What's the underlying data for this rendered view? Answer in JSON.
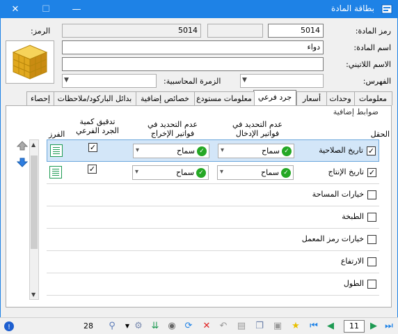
{
  "window": {
    "title": "بطاقة المادة",
    "close": "✕",
    "maximize": "☐",
    "minimize": "—"
  },
  "header": {
    "code_label": "رمز المادة:",
    "code_value": "5014",
    "symbol_label": "الرمز:",
    "symbol_value": "5014",
    "name_label": "اسم المادة:",
    "name_value": "دواء",
    "latin_label": "الاسم اللاتيني:",
    "latin_value": "",
    "index_label": "الفهرس:",
    "accounting_label": "الزمرة المحاسبية:"
  },
  "tabs": [
    {
      "label": "معلومات"
    },
    {
      "label": "وحدات"
    },
    {
      "label": "أسعار"
    },
    {
      "label": "جرد فرعي"
    },
    {
      "label": "معلومات مستودع"
    },
    {
      "label": "خصائص إضافية"
    },
    {
      "label": "بدائل الباركود/ملاحظات"
    },
    {
      "label": "إحصاء"
    }
  ],
  "grid": {
    "section_title": "ضوابط إضافية",
    "col_field": "الحقل",
    "col_entry_1": "عدم التحديد في",
    "col_entry_2": "فواتير الإدخال",
    "col_exit_1": "عدم التحديد في",
    "col_exit_2": "فواتير الإخراج",
    "col_audit_1": "تدقيق كمية",
    "col_audit_2": "الجرد الفرعي",
    "col_sort": "الفرز",
    "allow_text": "سماح",
    "rows": [
      {
        "label": "تاريخ الصلاحية",
        "checked": "✓",
        "audit": "✓"
      },
      {
        "label": "تاريخ الإنتاج",
        "checked": "✓",
        "audit": "✓"
      },
      {
        "label": "خيارات المساحة",
        "checked": "",
        "audit": ""
      },
      {
        "label": "الطبخة",
        "checked": "",
        "audit": ""
      },
      {
        "label": "خيارات رمز المعمل",
        "checked": "",
        "audit": ""
      },
      {
        "label": "الارتفاع",
        "checked": "",
        "audit": ""
      },
      {
        "label": "الطول",
        "checked": "",
        "audit": ""
      }
    ]
  },
  "statusbar": {
    "count": "28",
    "page": "11"
  },
  "colors": {
    "titlebar": "#1e82e6",
    "accent_green": "#1d9a52",
    "selected_row": "#d3e6f8"
  }
}
